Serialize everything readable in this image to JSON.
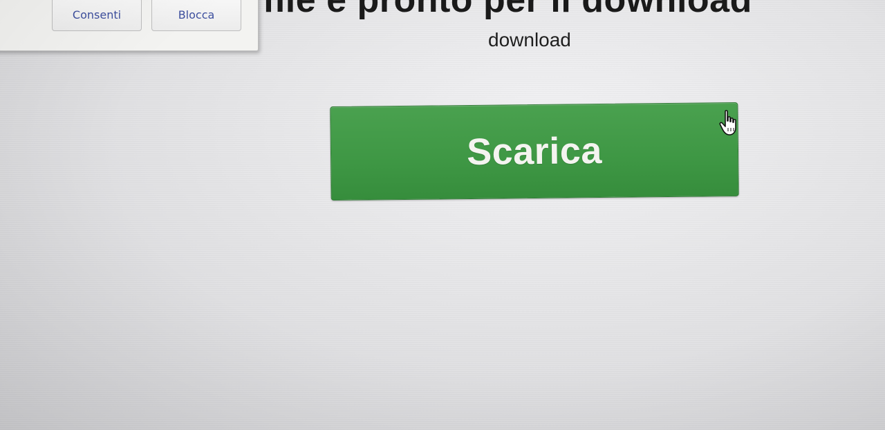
{
  "permission_popup": {
    "allow_label": "Consenti",
    "block_label": "Blocca"
  },
  "page": {
    "title": "file è pronto per il download",
    "subtitle": "download"
  },
  "download": {
    "button_label": "Scarica",
    "button_color": "#3e9744"
  },
  "cursor": {
    "icon": "hand-pointer-icon"
  }
}
